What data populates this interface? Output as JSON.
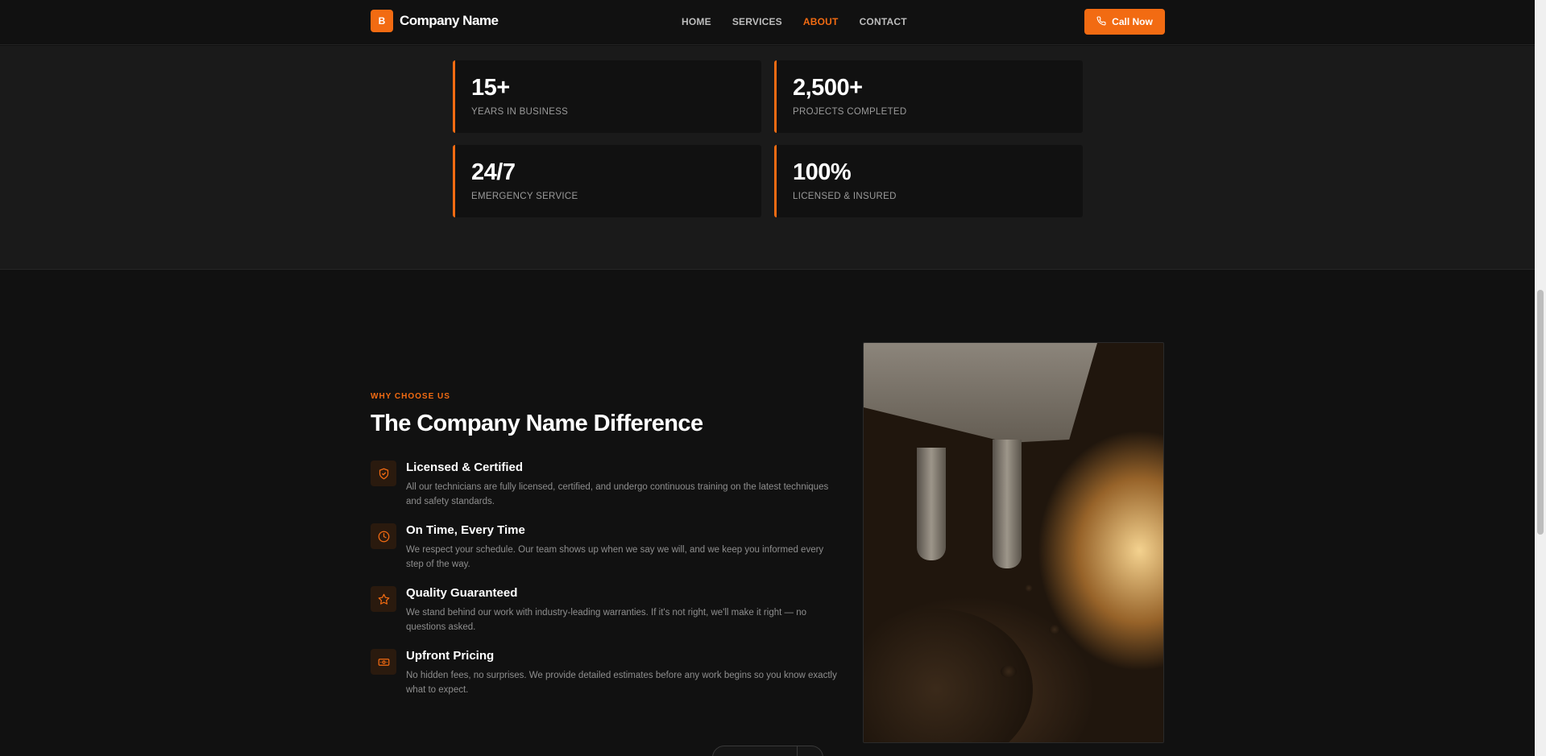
{
  "header": {
    "logo_letter": "B",
    "brand": "Company Name",
    "nav": [
      {
        "label": "HOME",
        "active": false
      },
      {
        "label": "SERVICES",
        "active": false
      },
      {
        "label": "ABOUT",
        "active": true
      },
      {
        "label": "CONTACT",
        "active": false
      }
    ],
    "cta_label": "Call Now",
    "cta_icon": "phone-icon"
  },
  "stats": [
    {
      "value": "15+",
      "label": "YEARS IN BUSINESS"
    },
    {
      "value": "2,500+",
      "label": "PROJECTS COMPLETED"
    },
    {
      "value": "24/7",
      "label": "EMERGENCY SERVICE"
    },
    {
      "value": "100%",
      "label": "LICENSED & INSURED"
    }
  ],
  "why": {
    "eyebrow": "WHY CHOOSE US",
    "title": "The Company Name Difference",
    "features": [
      {
        "icon": "shield-check-icon",
        "title": "Licensed & Certified",
        "desc": "All our technicians are fully licensed, certified, and undergo continuous training on the latest techniques and safety standards."
      },
      {
        "icon": "clock-icon",
        "title": "On Time, Every Time",
        "desc": "We respect your schedule. Our team shows up when we say we will, and we keep you informed every step of the way."
      },
      {
        "icon": "star-icon",
        "title": "Quality Guaranteed",
        "desc": "We stand behind our work with industry-leading warranties. If it's not right, we'll make it right — no questions asked."
      },
      {
        "icon": "money-bill-icon",
        "title": "Upfront Pricing",
        "desc": "No hidden fees, no surprises. We provide detailed estimates before any work begins so you know exactly what to expect."
      }
    ]
  },
  "colors": {
    "accent": "#f26b12",
    "background": "#111111",
    "stats_background": "#1a1a1a"
  }
}
